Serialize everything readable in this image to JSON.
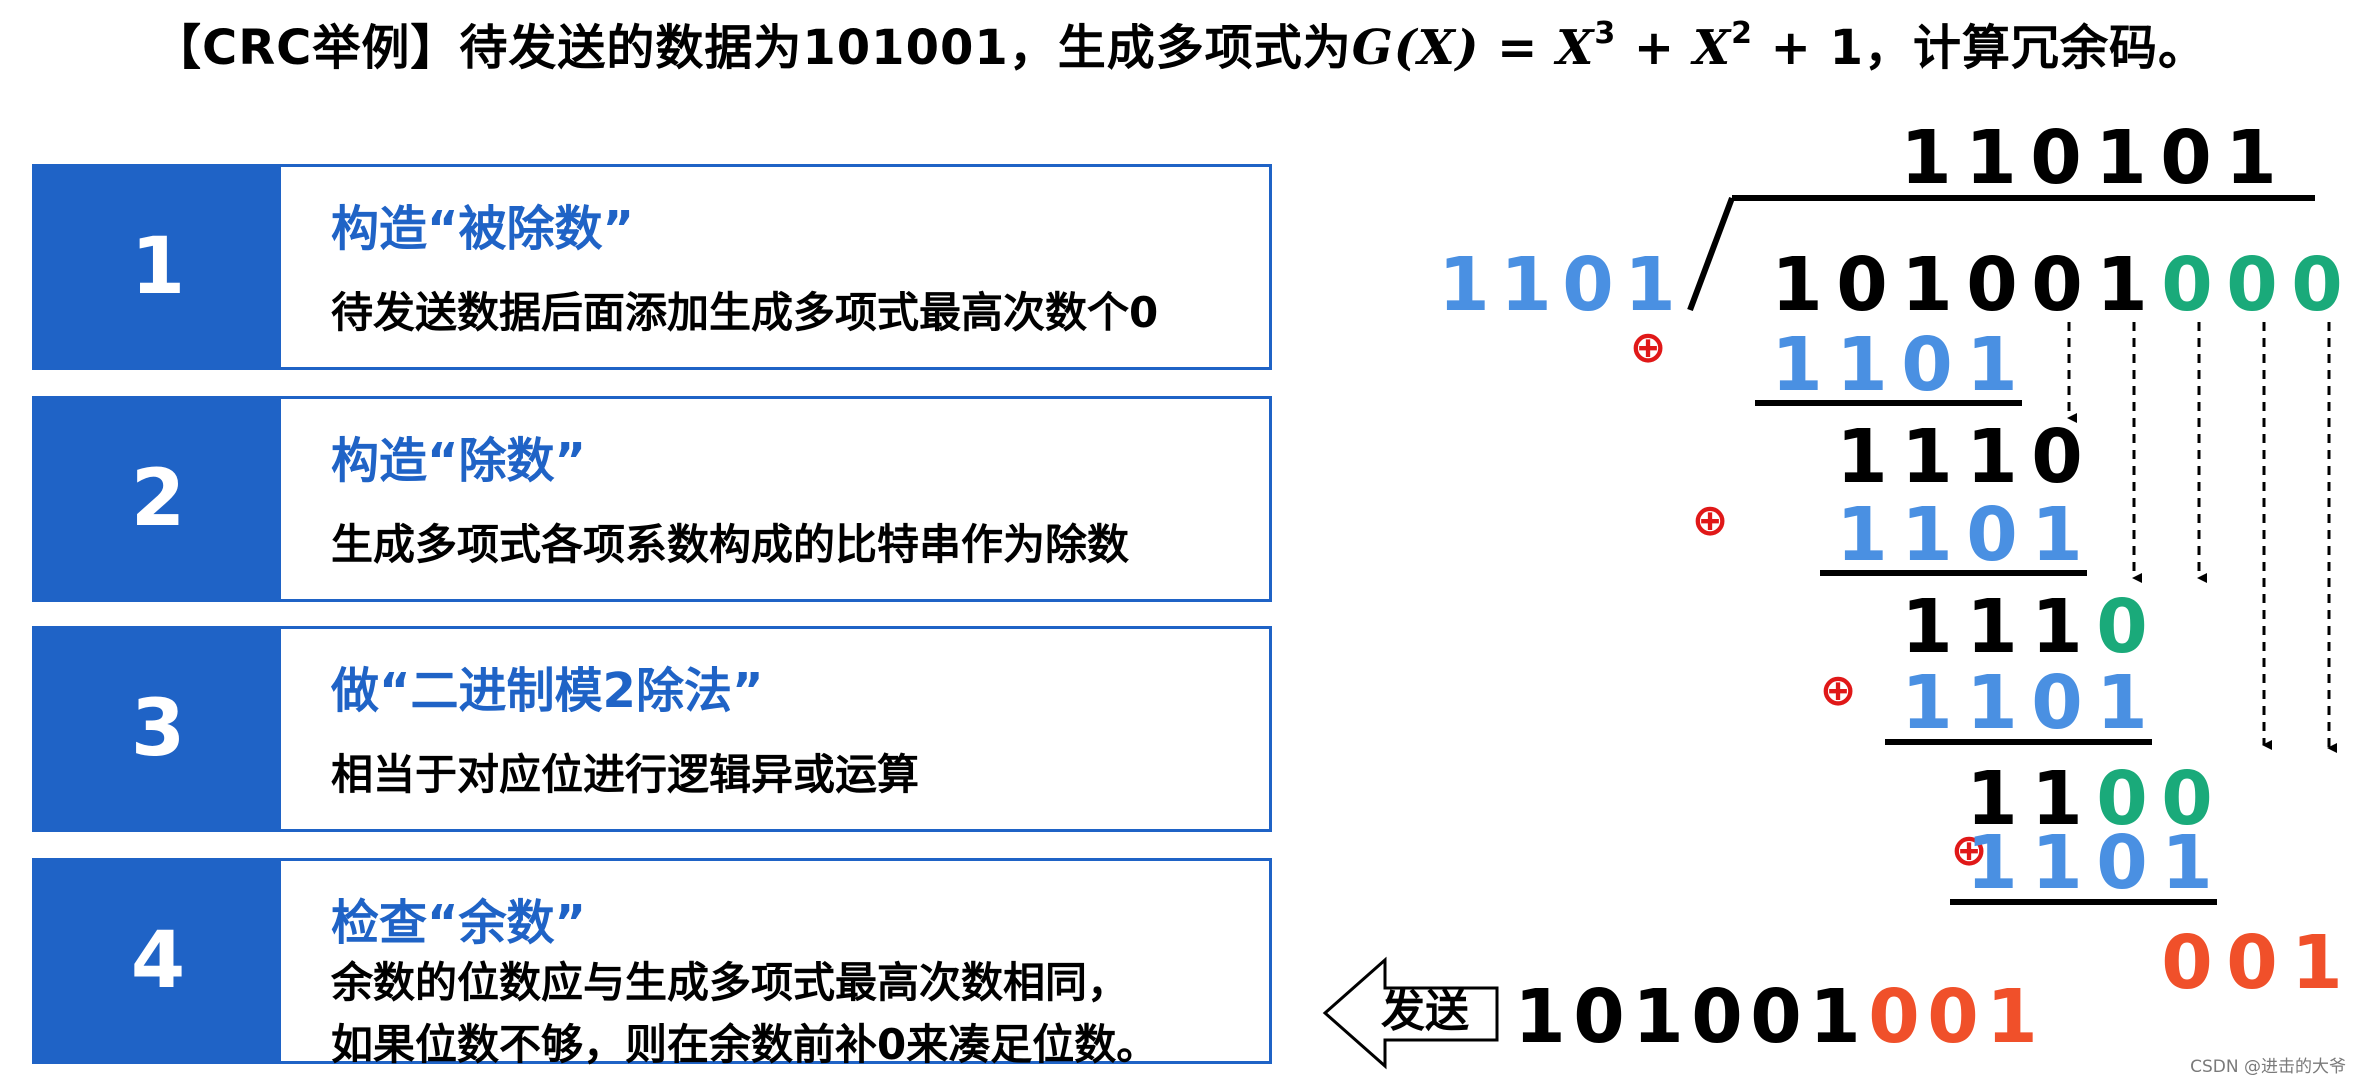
{
  "title": {
    "prefix": "【CRC举例】待发送的数据为101001，生成多项式为",
    "formula_g": "G(X)",
    "formula_eq": " = ",
    "x1": "X",
    "e1": "3",
    "plus1": " + ",
    "x2": "X",
    "e2": "2",
    "plus2": " + 1",
    "suffix": "，计算冗余码。"
  },
  "steps": [
    {
      "number": "1",
      "heading": "构造“被除数”",
      "desc": "待发送数据后面添加生成多项式最高次数个0"
    },
    {
      "number": "2",
      "heading": "构造“除数”",
      "desc": "生成多项式各项系数构成的比特串作为除数"
    },
    {
      "number": "3",
      "heading": "做“二进制模2除法”",
      "desc": "相当于对应位进行逻辑异或运算"
    },
    {
      "number": "4",
      "heading": "检查“余数”",
      "desc": "余数的位数应与生成多项式最高次数相同，",
      "desc2": "如果位数不够，则在余数前补0来凑足位数。"
    }
  ],
  "division": {
    "quotient": [
      "1",
      "1",
      "0",
      "1",
      "0",
      "1"
    ],
    "divisor": [
      "1",
      "1",
      "0",
      "1"
    ],
    "data_bits": [
      "1",
      "0",
      "1",
      "0",
      "0",
      "1"
    ],
    "appended_zeros": [
      "0",
      "0",
      "0"
    ],
    "xor_symbol": "⊕",
    "partials": [
      [
        "1",
        "1",
        "1",
        "0"
      ],
      [
        "1",
        "1",
        "1",
        "0"
      ],
      [
        "1",
        "1",
        "0",
        "0"
      ]
    ],
    "remainder": [
      "0",
      "0",
      "1"
    ],
    "send_label": "发送",
    "sent_data": [
      "1",
      "0",
      "1",
      "0",
      "0",
      "1"
    ],
    "sent_crc": [
      "0",
      "0",
      "1"
    ]
  },
  "colors": {
    "blue": "#1f63c6",
    "divisor_blue": "#4a90e2",
    "green": "#1aaa7a",
    "orange": "#f0502a",
    "xor_red": "#e01818"
  },
  "watermark": "CSDN @进击的大爷"
}
